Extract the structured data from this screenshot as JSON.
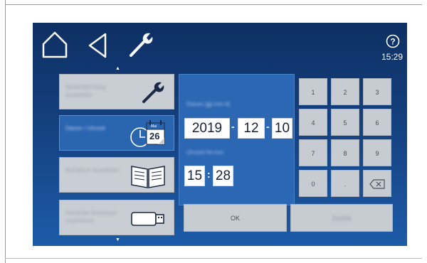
{
  "status": {
    "time": "15:29"
  },
  "menu": {
    "items": [
      {
        "label": "Sprachfahrzeug auswählen",
        "icon": "wrench-icon",
        "active": false
      },
      {
        "label": "Datum / Uhrzeit",
        "icon": "clock-calendar-icon",
        "active": true,
        "calendar_month": "Mai",
        "calendar_day": "26"
      },
      {
        "label": "Buchbuch auswählen",
        "icon": "book-icon",
        "active": false
      },
      {
        "label": "Hersteller Buchbuch exportieren",
        "icon": "usb-stick-icon",
        "active": false
      }
    ]
  },
  "datetime": {
    "date_label": "Datum (jjjj-mm-tt)",
    "year": "2019",
    "month": "12",
    "day": "10",
    "date_separator": "-",
    "time_label": "Uhrzeit hh:mm",
    "hour": "15",
    "minute": "28",
    "time_separator": ":"
  },
  "keypad": {
    "keys": [
      "1",
      "2",
      "3",
      "4",
      "5",
      "6",
      "7",
      "8",
      "9",
      "0",
      ".",
      "backspace"
    ]
  },
  "buttons": {
    "ok": "OK",
    "back": "Zurück"
  },
  "colors": {
    "background": "#14407e",
    "active": "#2a65b0",
    "key": "#c7ccd2"
  }
}
